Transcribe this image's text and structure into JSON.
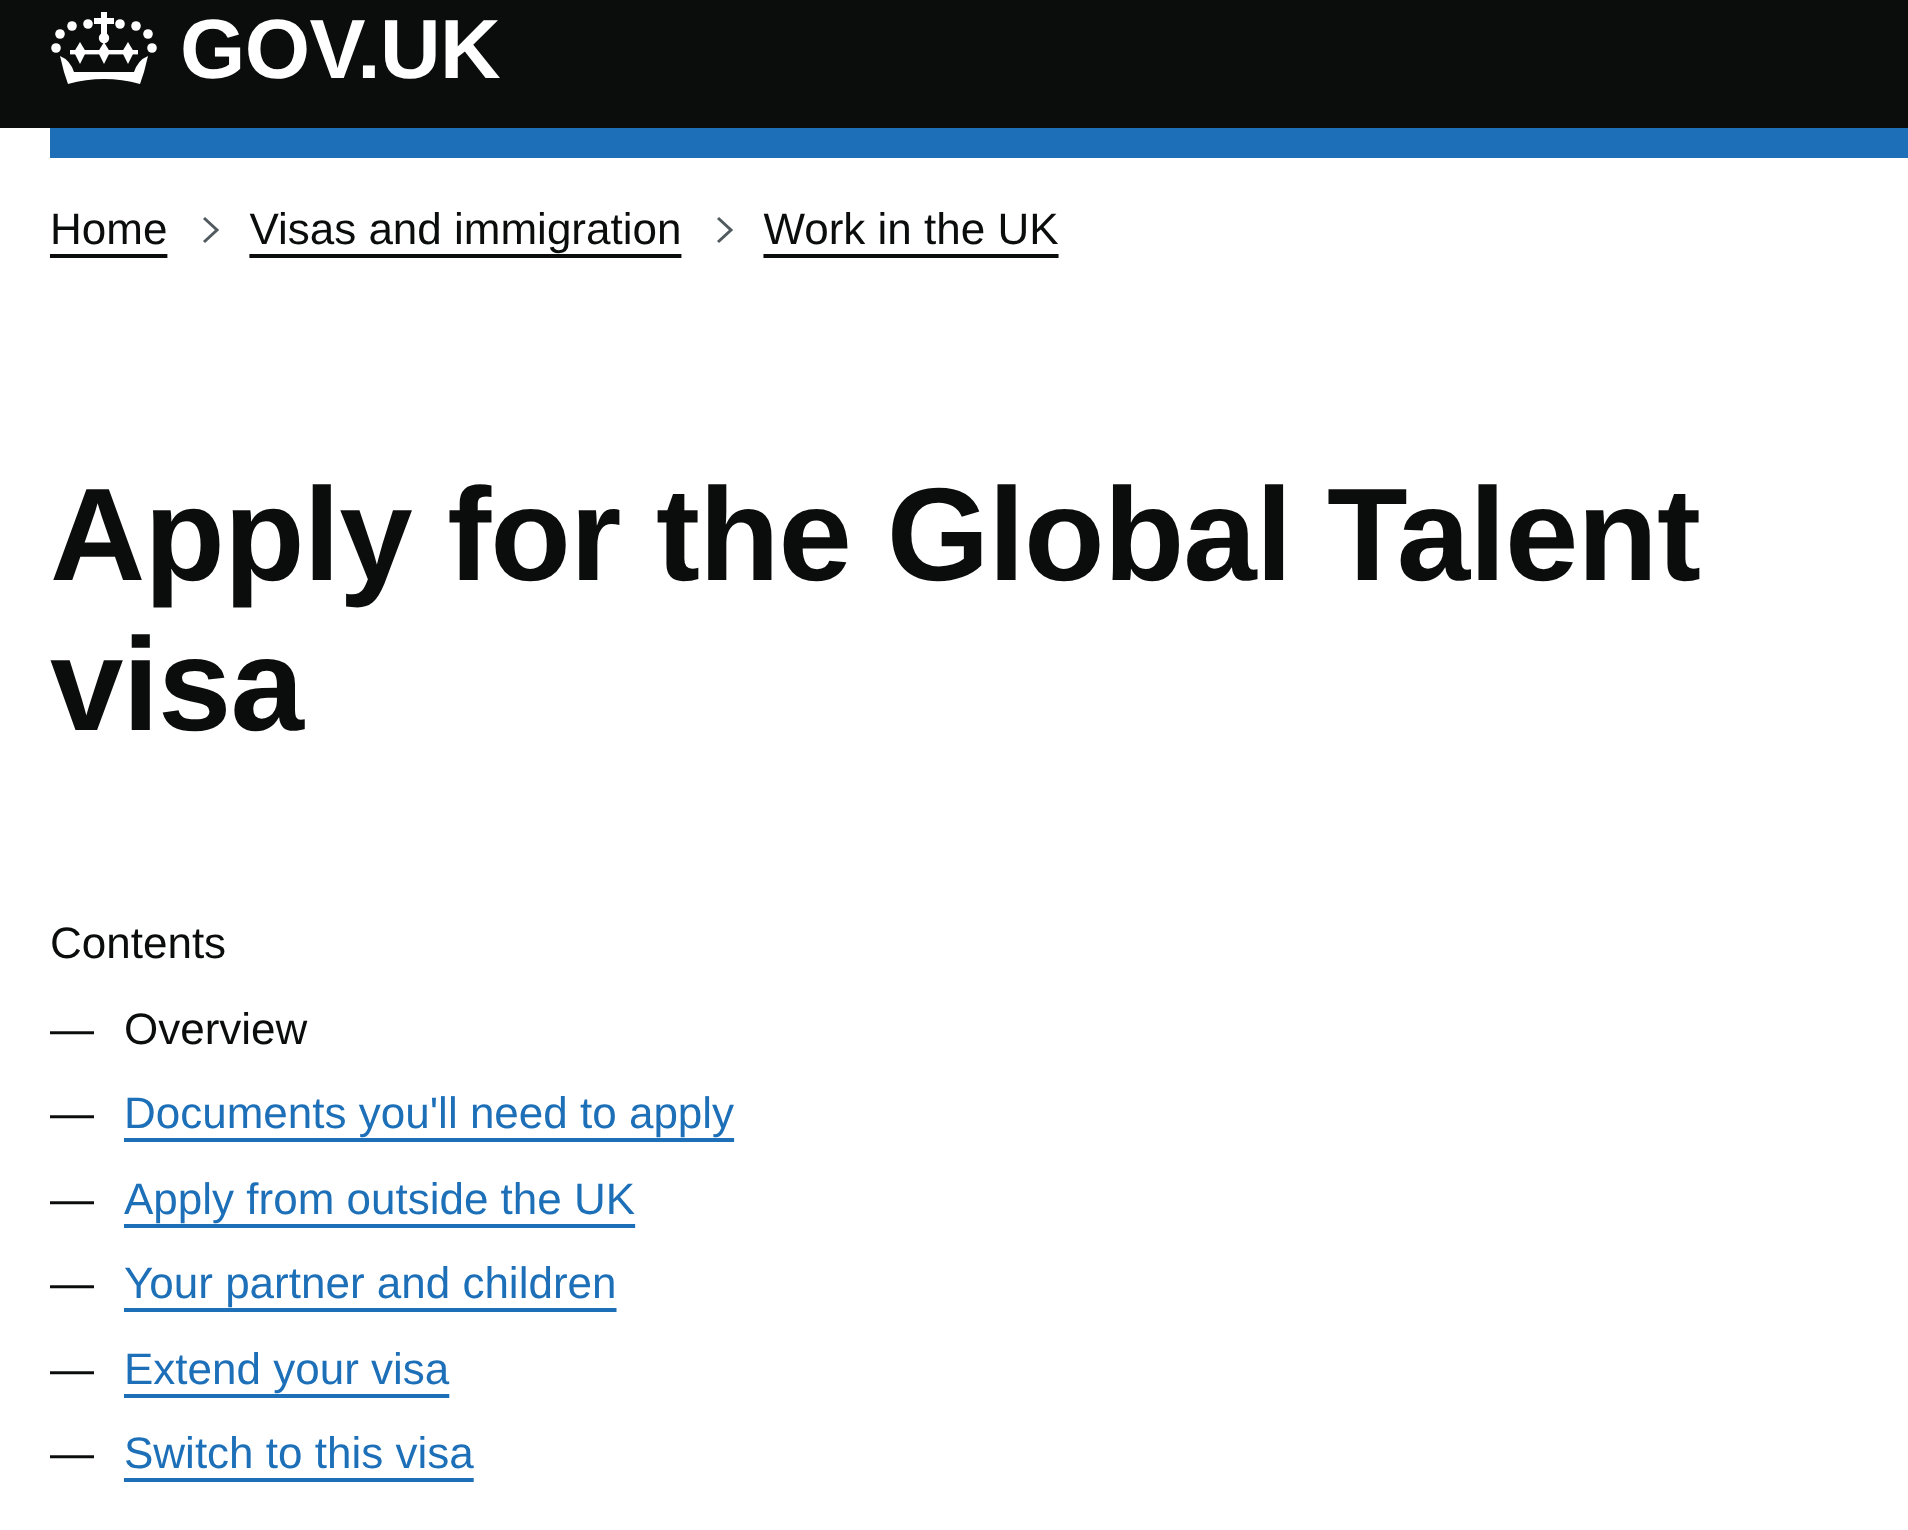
{
  "header": {
    "logo_text": "GOV.UK"
  },
  "breadcrumbs": [
    {
      "label": "Home"
    },
    {
      "label": "Visas and immigration"
    },
    {
      "label": "Work in the UK"
    }
  ],
  "title": "Apply for the Global Talent visa",
  "contents": {
    "heading": "Contents",
    "items": [
      {
        "marker": "—",
        "label": "Overview",
        "selected": true
      },
      {
        "marker": "—",
        "label": "Documents you'll need to apply",
        "selected": false
      },
      {
        "marker": "—",
        "label": "Apply from outside the UK",
        "selected": false
      },
      {
        "marker": "—",
        "label": "Your partner and children",
        "selected": false
      },
      {
        "marker": "—",
        "label": "Extend your visa",
        "selected": false
      },
      {
        "marker": "—",
        "label": "Switch to this visa",
        "selected": false
      }
    ]
  }
}
